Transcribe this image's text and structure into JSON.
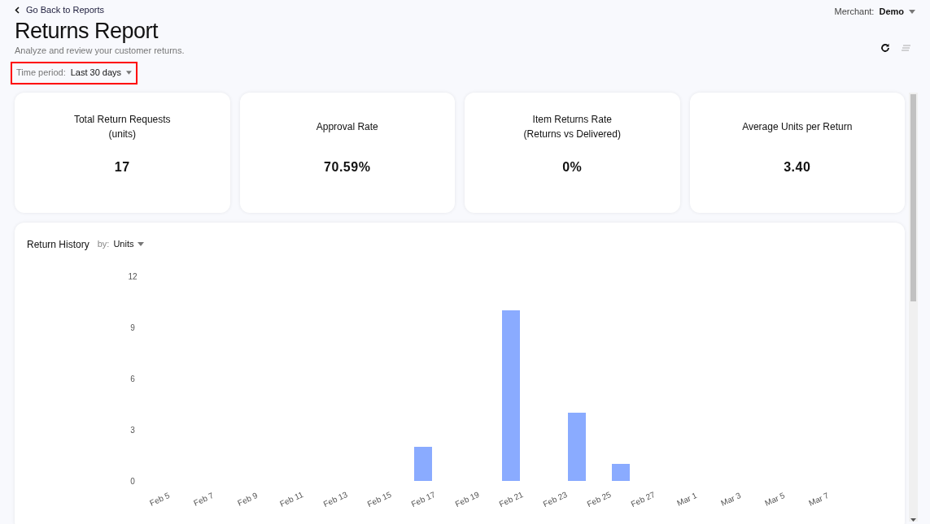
{
  "back_link": "Go Back to Reports",
  "merchant": {
    "label": "Merchant:",
    "value": "Demo"
  },
  "title": "Returns Report",
  "subtitle": "Analyze and review your customer returns.",
  "time_period": {
    "label": "Time period:",
    "value": "Last 30 days",
    "highlighted": true
  },
  "stats": [
    {
      "title": "Total Return Requests",
      "subtitle": "(units)",
      "value": "17"
    },
    {
      "title": "Approval Rate",
      "value": "70.59%"
    },
    {
      "title": "Item Returns Rate",
      "subtitle": "(Returns vs Delivered)",
      "value": "0%"
    },
    {
      "title": "Average Units per Return",
      "value": "3.40"
    }
  ],
  "history": {
    "title": "Return History",
    "by_label": "by:",
    "by_value": "Units",
    "chart_data": {
      "type": "bar",
      "categories": [
        "Feb 5",
        null,
        "Feb 7",
        null,
        "Feb 9",
        null,
        "Feb 11",
        null,
        "Feb 13",
        null,
        "Feb 15",
        null,
        "Feb 17",
        null,
        "Feb 19",
        null,
        "Feb 21",
        null,
        "Feb 23",
        null,
        "Feb 25",
        null,
        "Feb 27",
        null,
        "Mar 1",
        null,
        "Mar 3",
        null,
        "Mar 5",
        null,
        "Mar 7"
      ],
      "series": [
        {
          "color": "#8aabff",
          "values": [
            0,
            0,
            0,
            0,
            0,
            0,
            0,
            0,
            0,
            0,
            0,
            0,
            2,
            0,
            0,
            0,
            10,
            0,
            0,
            4,
            0,
            1,
            0,
            0,
            0,
            0,
            0,
            0,
            0,
            0,
            0
          ]
        }
      ],
      "ylim": [
        0,
        12
      ],
      "yticks": [
        0,
        3,
        6,
        9,
        12
      ]
    }
  }
}
